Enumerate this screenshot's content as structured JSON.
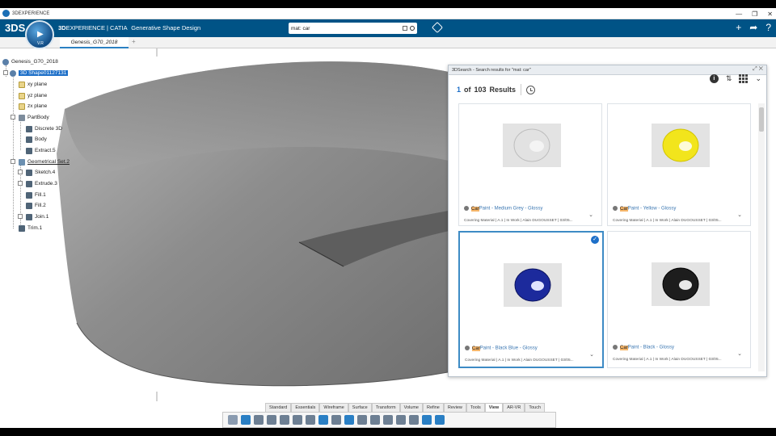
{
  "window": {
    "title": "3DEXPERIENCE",
    "controls": [
      "—",
      "❐",
      "✕"
    ]
  },
  "topbar": {
    "logo": "3DS",
    "brand_bold": "3D",
    "brand_rest": "EXPERIENCE | CATIA",
    "app_name": "Generative Shape Design",
    "compass_version": "V.R",
    "search_value": "mat: car",
    "right_icons": [
      "+",
      "➦",
      "?"
    ]
  },
  "tabs": {
    "active": "Genesis_G70_2018",
    "add": "+"
  },
  "tree": [
    {
      "label": "Genesis_G70_2018",
      "icon": "assembly-icon"
    },
    {
      "label": "3D Shape01127131",
      "icon": "part-icon",
      "selected": true
    },
    {
      "label": "xy plane",
      "icon": "plane-icon"
    },
    {
      "label": "yz plane",
      "icon": "plane-icon"
    },
    {
      "label": "zx plane",
      "icon": "plane-icon"
    },
    {
      "label": "PartBody",
      "icon": "body-icon"
    },
    {
      "label": "Discrete 3D",
      "icon": "feature-icon"
    },
    {
      "label": "Body",
      "icon": "feature-icon"
    },
    {
      "label": "Extract.5",
      "icon": "feature-icon"
    },
    {
      "label": "Geometrical Set.2",
      "icon": "geoset-icon"
    },
    {
      "label": "Sketch.4",
      "icon": "sketch-icon"
    },
    {
      "label": "Extrude.3",
      "icon": "feature-icon"
    },
    {
      "label": "Fill.1",
      "icon": "feature-icon"
    },
    {
      "label": "Fill.2",
      "icon": "feature-icon"
    },
    {
      "label": "Join.1",
      "icon": "feature-icon"
    },
    {
      "label": "Trim.1",
      "icon": "feature-icon"
    }
  ],
  "search_panel": {
    "title": "3DSearch - Search results for \"mat: car\"",
    "current": "1",
    "of": "of",
    "total": "103",
    "results_label": "Results",
    "results": [
      {
        "highlight": "Car",
        "name_rest": "Paint - Medium Grey - Glossy",
        "meta": "Covering Material | A.1 | In Work | Alain DUGOUSSET | 03/05...",
        "color": "#d9d9d9",
        "selected": false
      },
      {
        "highlight": "Car",
        "name_rest": "Paint - Yellow - Glossy",
        "meta": "Covering Material | A.1 | In Work | Alain DUGOUSSET | 03/05...",
        "color": "#f2e51c",
        "selected": false
      },
      {
        "highlight": "Car",
        "name_rest": "Paint - Black Blue - Glossy",
        "meta": "Covering Material | A.1 | In Work | Alain DUGOUSSET | 03/05...",
        "color": "#1c2a9c",
        "selected": true
      },
      {
        "highlight": "Car",
        "name_rest": "Paint - Black - Glossy",
        "meta": "Covering Material | A.1 | In Work | Alain DUGOUSSET | 03/05...",
        "color": "#1d1d1d",
        "selected": false
      }
    ]
  },
  "action_tabs": [
    "Standard",
    "Essentials",
    "Wireframe",
    "Surface",
    "Transform",
    "Volume",
    "Refine",
    "Review",
    "Tools",
    "View",
    "AR-VR",
    "Touch"
  ],
  "active_action_tab": "View",
  "colors": {
    "brand_blue": "#005386",
    "selection_blue": "#1d6fc8",
    "hood_grey": "#8a8a8a"
  }
}
